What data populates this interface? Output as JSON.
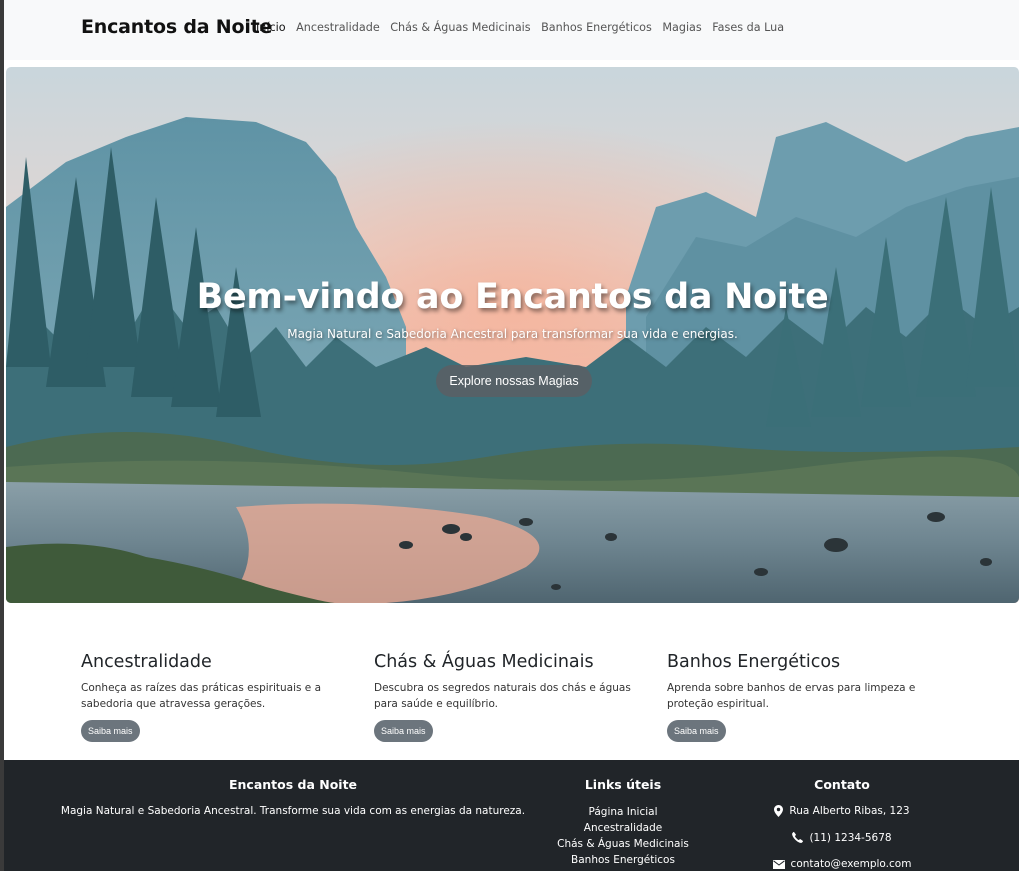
{
  "navbar": {
    "brand": "Encantos da Noite",
    "links": [
      "Início",
      "Ancestralidade",
      "Chás & Águas Medicinais",
      "Banhos Energéticos",
      "Magias",
      "Fases da Lua"
    ]
  },
  "hero": {
    "title": "Bem-vindo ao Encantos da Noite",
    "subtitle": "Magia Natural e Sabedoria Ancestral para transformar sua vida e energias.",
    "button": "Explore nossas Magias"
  },
  "features": [
    {
      "title": "Ancestralidade",
      "text": "Conheça as raízes das práticas espirituais e a sabedoria que atravessa gerações.",
      "button": "Saiba mais"
    },
    {
      "title": "Chás & Águas Medicinais",
      "text": "Descubra os segredos naturais dos chás e águas para saúde e equilíbrio.",
      "button": "Saiba mais"
    },
    {
      "title": "Banhos Energéticos",
      "text": "Aprenda sobre banhos de ervas para limpeza e proteção espiritual.",
      "button": "Saiba mais"
    }
  ],
  "footer": {
    "about": {
      "title": "Encantos da Noite",
      "text": "Magia Natural e Sabedoria Ancestral. Transforme sua vida com as energias da natureza."
    },
    "links": {
      "title": "Links úteis",
      "items": [
        "Página Inicial",
        "Ancestralidade",
        "Chás & Águas Medicinais",
        "Banhos Energéticos"
      ]
    },
    "contact": {
      "title": "Contato",
      "address": "Rua Alberto Ribas, 123",
      "phone": "(11) 1234-5678",
      "email": "contato@exemplo.com"
    }
  },
  "icons": {
    "address": "map-pin-icon",
    "phone": "phone-icon",
    "email": "envelope-icon"
  }
}
